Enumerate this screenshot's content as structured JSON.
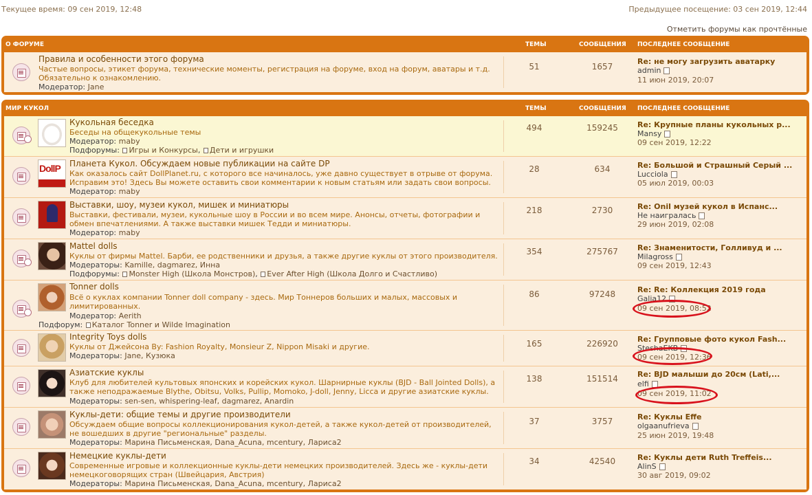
{
  "top": {
    "current_time": "Текущее время: 09 сен 2019, 12:48",
    "previous_visit": "Предыдущее посещение: 03 сен 2019, 12:44",
    "mark_read": "Отметить форумы как прочтённые"
  },
  "about": {
    "header": {
      "title": "О ФОРУМЕ",
      "topics": "ТЕМЫ",
      "posts": "СООБЩЕНИЯ",
      "last": "ПОСЛЕДНЕЕ СООБЩЕНИЕ"
    },
    "forum": {
      "title": "Правила и особенности этого форума",
      "desc": "Частые вопросы, этикет форума, технические моменты, регистрация на форуме, вход на форум, аватары и т.д. Обязательно к ознакомлению.",
      "mod_label": "Модератор:",
      "mods": "Jane",
      "topics": "51",
      "posts": "1657",
      "last_title": "Re: не могу загрузить аватарку",
      "last_author": "admin",
      "last_time": "11 июн 2019, 20:07"
    }
  },
  "world": {
    "header": {
      "title": "МИР КУКОЛ",
      "topics": "ТЕМЫ",
      "posts": "СООБЩЕНИЯ",
      "last": "ПОСЛЕДНЕЕ СООБЩЕНИЕ"
    },
    "forums": [
      {
        "title": "Кукольная беседка",
        "desc": "Беседы на общекукольные темы",
        "mod_label": "Модератор:",
        "mods": "maby",
        "sub_label": "Подфорумы:",
        "subs": [
          "Игры и Конкурсы",
          "Дети и игрушки"
        ],
        "topics": "494",
        "posts": "159245",
        "last_title": "Re: Крупные планы кукольных р...",
        "last_author": "Mansy",
        "last_time": "09 сен 2019, 12:22"
      },
      {
        "title": "Планета Кукол. Обсуждаем новые публикации на сайте DP",
        "desc": "Как оказалось сайт DollPlanet.ru, с которого все начиналось, уже давно существует в отрыве от форума. Исправим это! Здесь Вы можете оставить свои комментарии к новым статьям или задать свои вопросы.",
        "mod_label": "Модератор:",
        "mods": "maby",
        "topics": "28",
        "posts": "634",
        "last_title": "Re: Большой и Страшный Серый ...",
        "last_author": "Lucciola",
        "last_time": "05 июл 2019, 00:03"
      },
      {
        "title": "Выставки, шоу, музеи кукол, мишек и миниатюры",
        "desc": "Выставки, фестивали, музеи, кукольные шоу в России и во всем мире. Анонсы, отчеты, фотографии и обмен впечатлениями. А также выставки мишек Тедди и миниатюры.",
        "mod_label": "Модератор:",
        "mods": "maby",
        "topics": "218",
        "posts": "2730",
        "last_title": "Re: Onil музей кукол в Испанс...",
        "last_author": "Не наигралась",
        "last_time": "29 июн 2019, 02:08"
      },
      {
        "title": "Mattel dolls",
        "desc": "Куклы от фирмы Mattel. Барби, ее родственники и друзья, а также другие куклы от этого производителя.",
        "mod_label": "Модераторы:",
        "mods": "Kamille, dagmarez, Инна",
        "sub_label": "Подфорумы:",
        "subs": [
          "Monster High (Школа Монстров)",
          "Ever After High (Школа Долго и Счастливо)"
        ],
        "topics": "354",
        "posts": "275767",
        "last_title": "Re: Знаменитости, Голливуд и ...",
        "last_author": "Milagross",
        "last_time": "09 сен 2019, 12:43"
      },
      {
        "title": "Tonner dolls",
        "desc": "Всё о куклах компании Tonner doll company - здесь. Мир Тоннеров больших и малых, массовых и лимитированных.",
        "mod_label": "Модератор:",
        "mods": "Aerith",
        "sub_label": "Подфорум:",
        "subs": [
          "Каталог Tonner и Wilde Imagination"
        ],
        "topics": "86",
        "posts": "97248",
        "last_title": "Re: Re: Коллекция 2019 года",
        "last_author": "Galia12",
        "last_time": "09 сен 2019, 08:52"
      },
      {
        "title": "Integrity Toys dolls",
        "desc": "Куклы от Джейсона By: Fashion Royalty, Monsieur Z, Nippon Misaki и другие.",
        "mod_label": "Модераторы:",
        "mods": "Jane, Кузюка",
        "topics": "165",
        "posts": "226920",
        "last_title": "Re: Групповые фото кукол Fash...",
        "last_author": "SteshaEKB",
        "last_time": "09 сен 2019, 12:36"
      },
      {
        "title": "Азиатские куклы",
        "desc": "Клуб для любителей культовых японских и корейских кукол. Шарнирные куклы (BJD - Ball Jointed Dolls), а также неподражаемые Blythe, Obitsu, Volks, Pullip, Momoko, J-doll, Jenny, Licca и другие азиатские куклы.",
        "mod_label": "Модераторы:",
        "mods": "sen-sen, whispering-leaf, dagmarez, Anardin",
        "topics": "138",
        "posts": "151514",
        "last_title": "Re: BJD малыши до 20см (Lati,...",
        "last_author": "elfi",
        "last_time": "09 сен 2019, 11:02"
      },
      {
        "title": "Куклы-дети: общие темы и другие производители",
        "desc": "Обсуждаем общие вопросы коллекционирования кукол-детей, а также кукол-детей от производителей, не вошедших в другие \"региональные\" разделы.",
        "mod_label": "Модераторы:",
        "mods": "Марина Письменская, Dana_Acuna, mcentury, Лариса2",
        "topics": "37",
        "posts": "3757",
        "last_title": "Re: Куклы Effe",
        "last_author": "olgaanufrieva",
        "last_time": "25 июн 2019, 19:48"
      },
      {
        "title": "Немецкие куклы-дети",
        "desc": "Современные игровые и коллекционные куклы-дети немецких производителей. Здесь же - куклы-дети немецкоговорящих стран (Швейцария, Австрия)",
        "mod_label": "Модераторы:",
        "mods": "Марина Письменская, Dana_Acuna, mcentury, Лариса2",
        "topics": "34",
        "posts": "42540",
        "last_title": "Re: Куклы дети Ruth Treffeis...",
        "last_author": "AlinS",
        "last_time": "30 авг 2019, 09:02"
      }
    ]
  },
  "colors": {
    "accent": "#d97512",
    "row": "#fbeedd",
    "highlight_row": "#fbf7d3",
    "annotation": "#d8121c"
  }
}
